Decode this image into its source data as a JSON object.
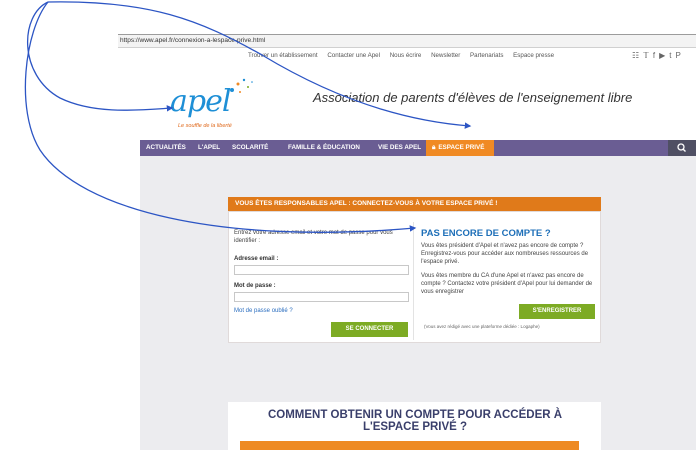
{
  "browser": {
    "url": "https://www.apel.fr/connexion-a-lespace-prive.html"
  },
  "topnav": {
    "items": [
      "Trouver un établissement",
      "Contacter une Apel",
      "Nous écrire",
      "Newsletter",
      "Partenariats",
      "Espace presse"
    ],
    "social_icons": [
      "rss-icon",
      "twitter-icon",
      "facebook-icon",
      "youtube-icon",
      "tumblr-icon",
      "pinterest-icon"
    ]
  },
  "logo": {
    "text": "apel",
    "tagline": "Le souffle de la liberté"
  },
  "header": {
    "tagline": "Association de parents d'élèves de l'enseignement libre"
  },
  "mainnav": {
    "items": [
      "ACTUALITÉS",
      "L'APEL",
      "SCOLARITÉ",
      "FAMILLE & ÉDUCATION",
      "VIE DES APEL"
    ],
    "espace_prive": "ESPACE PRIVÉ"
  },
  "login": {
    "banner": "VOUS ÊTES RESPONSABLES APEL : CONNECTEZ-VOUS À VOTRE ESPACE PRIVÉ !",
    "description": "Entrez votre adresse email et votre mot de passe pour vous identifier :",
    "email_label": "Adresse email :",
    "password_label": "Mot de passe :",
    "forgot": "Mot de passe oublié ?",
    "submit": "SE CONNECTER"
  },
  "register": {
    "title": "PAS ENCORE DE COMPTE ?",
    "p1": "Vous êtes président d'Apel et n'avez pas encore de compte ? Enregistrez-vous pour accéder aux nombreuses ressources de l'espace privé.",
    "p2": "Vous êtes membre du CA d'une Apel et n'avez pas encore de compte ? Contactez votre président d'Apel pour lui demander de vous enregistrer",
    "button": "S'ENREGISTRER",
    "note": "(Vous avez rédigé avec une plateforme dédiée : Logaphe)"
  },
  "howto": {
    "title": "COMMENT OBTENIR UN COMPTE POUR ACCÉDER À L'ESPACE PRIVÉ ?"
  },
  "colors": {
    "nav": "#6a5d93",
    "accent": "#f08a24",
    "button": "#7dab24",
    "link": "#1e6fb8",
    "arrow": "#2c55c4"
  }
}
